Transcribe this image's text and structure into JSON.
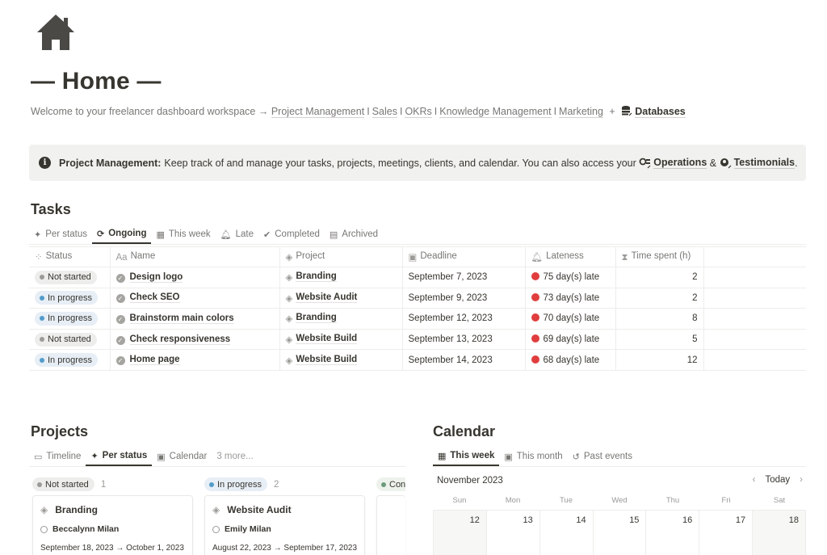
{
  "page": {
    "icon": "house-icon",
    "title": "— Home —",
    "welcome_text": "Welcome to your freelancer dashboard workspace →",
    "nav_links": [
      "Project Management",
      "Sales",
      "OKRs",
      "Knowledge Management",
      "Marketing"
    ],
    "nav_separator": "I",
    "plus": "+",
    "databases_label": "Databases"
  },
  "callout": {
    "icon": "info-icon",
    "bold": "Project Management:",
    "text": "Keep track of and manage your tasks, projects, meetings, clients, and calendar. You can also access your",
    "link1": "Operations",
    "amp": "&",
    "link2": "Testimonials",
    "end": "."
  },
  "tasks": {
    "title": "Tasks",
    "tabs": [
      {
        "label": "Per status",
        "icon": "sparkle-icon",
        "active": false
      },
      {
        "label": "Ongoing",
        "icon": "refresh-icon",
        "active": true
      },
      {
        "label": "This week",
        "icon": "calendar-icon",
        "active": false
      },
      {
        "label": "Late",
        "icon": "bell-icon",
        "active": false
      },
      {
        "label": "Completed",
        "icon": "check-circle-icon",
        "active": false
      },
      {
        "label": "Archived",
        "icon": "archive-icon",
        "active": false
      }
    ],
    "columns": [
      "Status",
      "Name",
      "Project",
      "Deadline",
      "Lateness",
      "Time spent (h)"
    ],
    "rows": [
      {
        "status": "Not started",
        "name": "Design logo",
        "project": "Branding",
        "deadline": "September 7, 2023",
        "lateness": "75 day(s) late",
        "time": "2"
      },
      {
        "status": "In progress",
        "name": "Check SEO",
        "project": "Website Audit",
        "deadline": "September 9, 2023",
        "lateness": "73 day(s) late",
        "time": "2"
      },
      {
        "status": "In progress",
        "name": "Brainstorm main colors",
        "project": "Branding",
        "deadline": "September 12, 2023",
        "lateness": "70 day(s) late",
        "time": "8"
      },
      {
        "status": "Not started",
        "name": "Check responsiveness",
        "project": "Website Build",
        "deadline": "September 13, 2023",
        "lateness": "69 day(s) late",
        "time": "5"
      },
      {
        "status": "In progress",
        "name": "Home page",
        "project": "Website Build",
        "deadline": "September 14, 2023",
        "lateness": "68 day(s) late",
        "time": "12"
      }
    ],
    "colors": {
      "not_started": "#9b9a97",
      "in_progress": "#529cca",
      "late": "#e03e3e"
    }
  },
  "projects": {
    "title": "Projects",
    "tabs": [
      {
        "label": "Timeline",
        "icon": "timeline-icon",
        "active": false
      },
      {
        "label": "Per status",
        "icon": "sparkle-icon",
        "active": true
      },
      {
        "label": "Calendar",
        "icon": "calendar-icon",
        "active": false
      },
      {
        "label": "3 more...",
        "icon": "",
        "active": false
      }
    ],
    "groups": [
      {
        "label": "Not started",
        "count": "1",
        "color": "#9b9a97"
      },
      {
        "label": "In progress",
        "count": "2",
        "color": "#529cca"
      },
      {
        "label": "Con",
        "count": "",
        "color": "#6c9b7d"
      }
    ],
    "cards": [
      {
        "title": "Branding",
        "person": "Beccalynn Milan",
        "dates": "September 18, 2023 → October 1, 2023"
      },
      {
        "title": "Website Audit",
        "person": "Emily Milan",
        "dates": "August 22, 2023 → September 17, 2023"
      }
    ]
  },
  "calendar": {
    "title": "Calendar",
    "tabs": [
      {
        "label": "This week",
        "icon": "calendar-icon",
        "active": true
      },
      {
        "label": "This month",
        "icon": "calendar-outline-icon",
        "active": false
      },
      {
        "label": "Past events",
        "icon": "history-icon",
        "active": false
      }
    ],
    "month": "November 2023",
    "today": "Today",
    "prev": "‹",
    "next": "›",
    "weekdays": [
      "Sun",
      "Mon",
      "Tue",
      "Wed",
      "Thu",
      "Fri",
      "Sat"
    ],
    "days": [
      "12",
      "13",
      "14",
      "15",
      "16",
      "17",
      "18"
    ]
  }
}
